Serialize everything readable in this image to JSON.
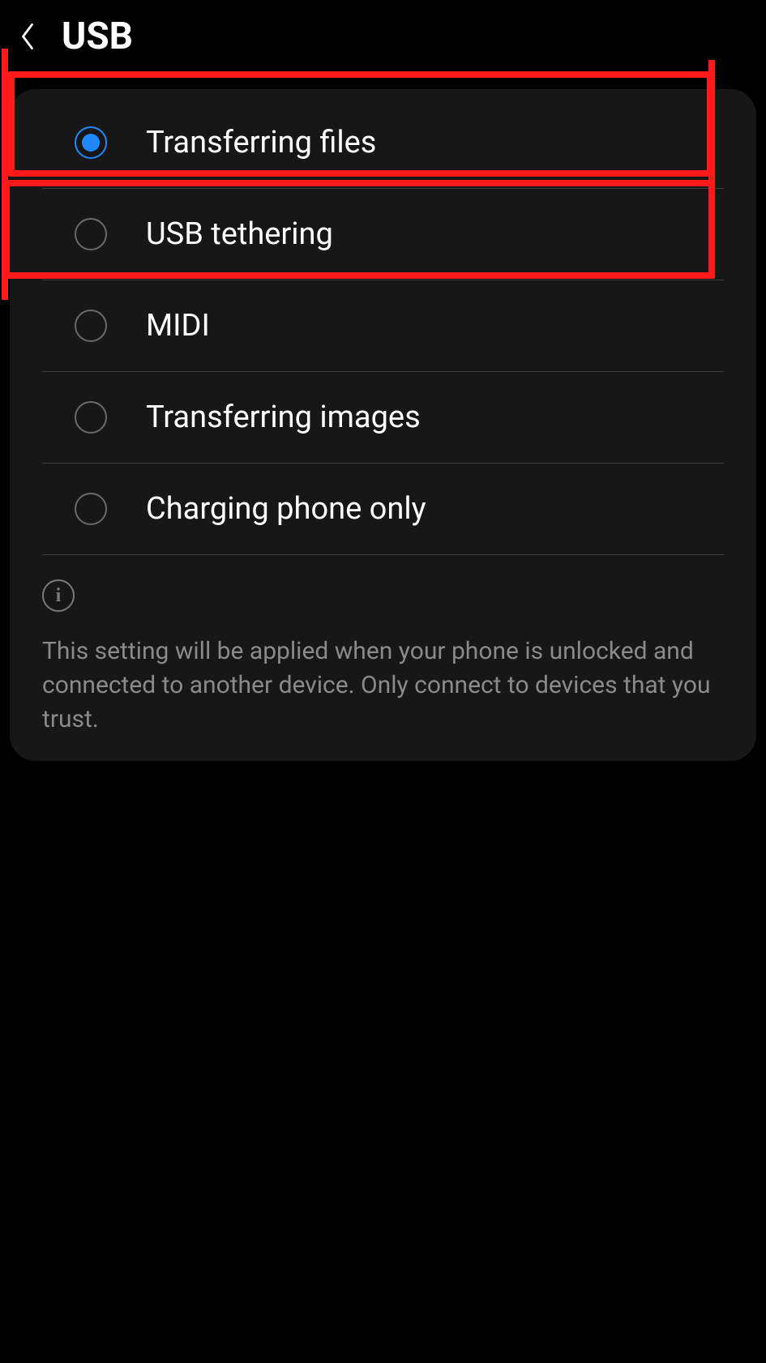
{
  "header": {
    "title": "USB"
  },
  "options": [
    {
      "label": "Transferring files",
      "selected": true
    },
    {
      "label": "USB tethering",
      "selected": false
    },
    {
      "label": "MIDI",
      "selected": false
    },
    {
      "label": "Transferring images",
      "selected": false
    },
    {
      "label": "Charging phone only",
      "selected": false
    }
  ],
  "info": {
    "text": "This setting will be applied when your phone is unlocked and connected to another device. Only connect to devices that you trust."
  },
  "annotations": {
    "highlight_color": "#ff1a1a",
    "highlighted_indices": [
      0,
      1
    ]
  }
}
